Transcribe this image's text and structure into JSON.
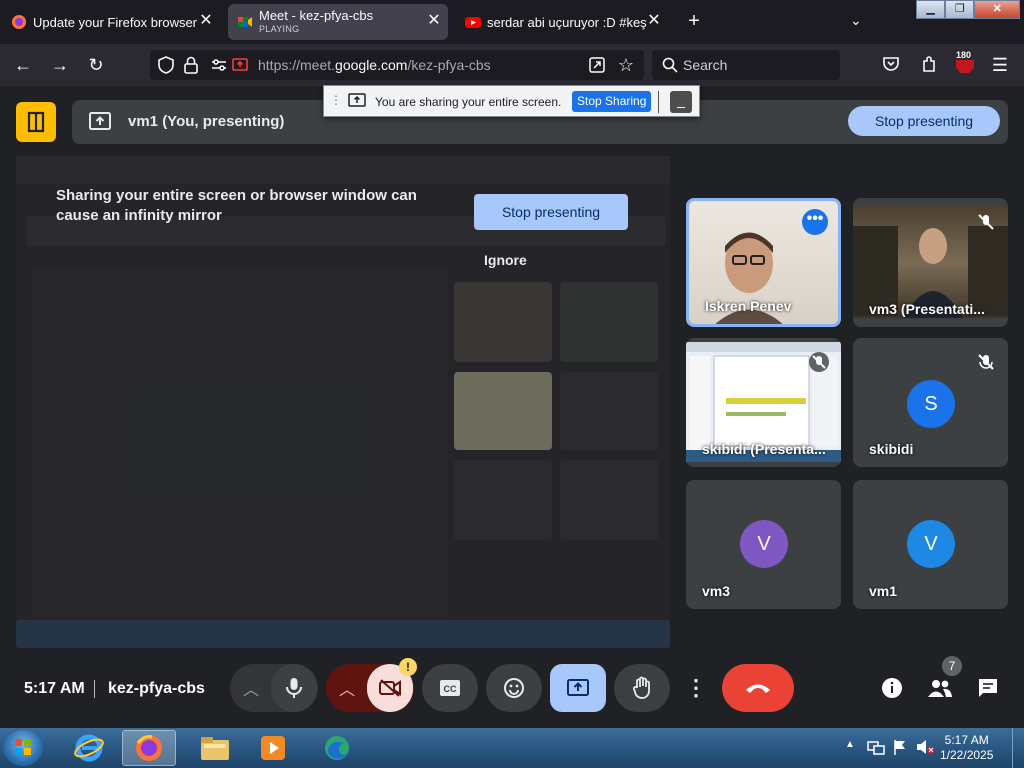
{
  "browser": {
    "tabs": [
      {
        "title": "Update your Firefox browser",
        "subtitle": ""
      },
      {
        "title": "Meet - kez-pfya-cbs",
        "subtitle": "PLAYING"
      },
      {
        "title": "serdar abi uçuruyor :D #keşfet",
        "subtitle": ""
      }
    ],
    "new_tab_label": "+",
    "url_prefix": "https://meet.",
    "url_host": "google.com",
    "url_path": "/kez-pfya-cbs",
    "search_placeholder": "Search",
    "extension_badge": "180"
  },
  "share_popup": {
    "message": "You are sharing your entire screen.",
    "stop_label": "Stop Sharing"
  },
  "meet": {
    "presenting_label": "vm1 (You, presenting)",
    "stop_presenting_label": "Stop presenting",
    "mirror_warning": "Sharing your entire screen or browser window can cause an infinity mirror",
    "mirror_stop_label": "Stop presenting",
    "ignore_label": "Ignore",
    "tiles": [
      {
        "name": "Iskren Penev",
        "kind": "video",
        "avatar": "",
        "color": ""
      },
      {
        "name": "vm3 (Presentati...",
        "kind": "video",
        "avatar": "",
        "color": ""
      },
      {
        "name": "skibidi (Presenta...",
        "kind": "screen",
        "avatar": "",
        "color": ""
      },
      {
        "name": "skibidi",
        "kind": "avatar",
        "avatar": "S",
        "color": "#1a73e8"
      },
      {
        "name": "vm3",
        "kind": "avatar",
        "avatar": "V",
        "color": "#7e57c2"
      },
      {
        "name": "vm1",
        "kind": "avatar",
        "avatar": "V",
        "color": "#1e88e5"
      }
    ],
    "time": "5:17 AM",
    "meeting_code": "kez-pfya-cbs",
    "camera_alert": "!",
    "participants_count": "7"
  },
  "taskbar": {
    "time": "5:17 AM",
    "date": "1/22/2025"
  },
  "colors": {
    "accent_blue": "#a8c7fa",
    "hangup_red": "#ea4335",
    "meet_bg": "#202124"
  }
}
